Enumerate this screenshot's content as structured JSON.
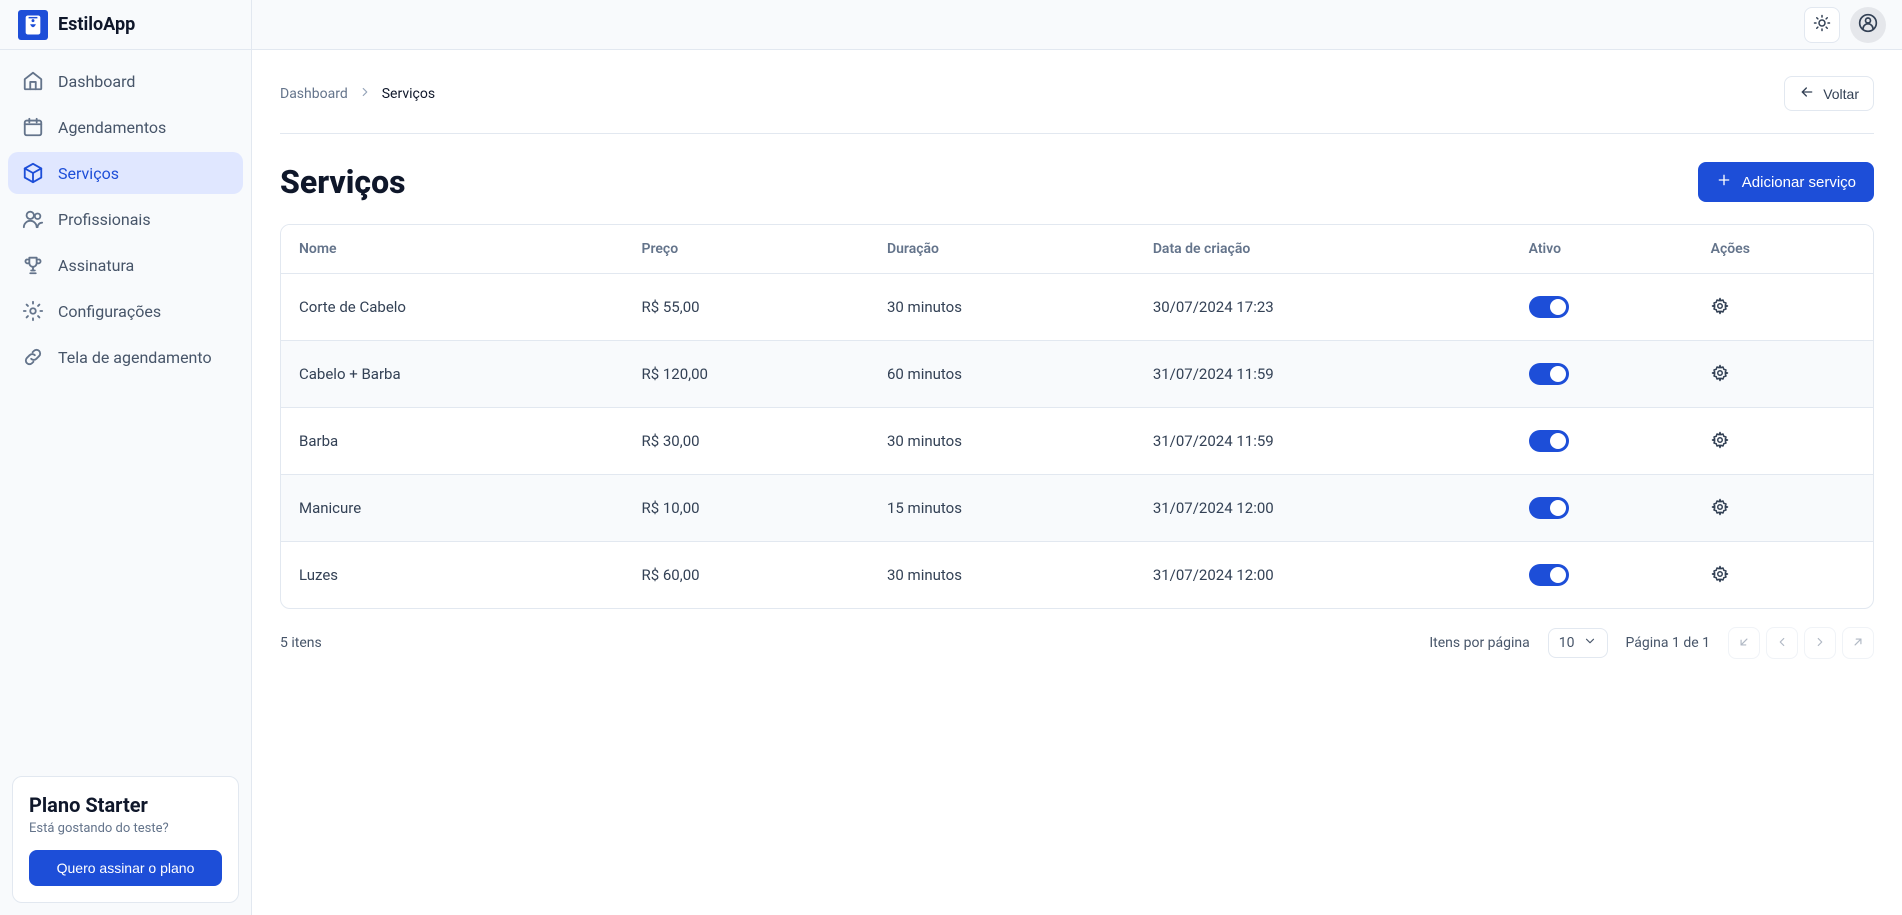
{
  "brand": "EstiloApp",
  "sidebar": {
    "items": [
      {
        "label": "Dashboard"
      },
      {
        "label": "Agendamentos"
      },
      {
        "label": "Serviços"
      },
      {
        "label": "Profissionais"
      },
      {
        "label": "Assinatura"
      },
      {
        "label": "Configurações"
      },
      {
        "label": "Tela de agendamento"
      }
    ]
  },
  "plan": {
    "title": "Plano Starter",
    "subtitle": "Está gostando do teste?",
    "cta": "Quero assinar o plano"
  },
  "breadcrumb": {
    "root": "Dashboard",
    "current": "Serviços"
  },
  "back_label": "Voltar",
  "page": {
    "title": "Serviços",
    "add_label": "Adicionar serviço"
  },
  "table": {
    "columns": {
      "name": "Nome",
      "price": "Preço",
      "duration": "Duração",
      "created": "Data de criação",
      "active": "Ativo",
      "actions": "Ações"
    },
    "rows": [
      {
        "name": "Corte de Cabelo",
        "price": "R$ 55,00",
        "duration": "30 minutos",
        "created": "30/07/2024 17:23",
        "active": true
      },
      {
        "name": "Cabelo + Barba",
        "price": "R$ 120,00",
        "duration": "60 minutos",
        "created": "31/07/2024 11:59",
        "active": true
      },
      {
        "name": "Barba",
        "price": "R$ 30,00",
        "duration": "30 minutos",
        "created": "31/07/2024 11:59",
        "active": true
      },
      {
        "name": "Manicure",
        "price": "R$ 10,00",
        "duration": "15 minutos",
        "created": "31/07/2024 12:00",
        "active": true
      },
      {
        "name": "Luzes",
        "price": "R$ 60,00",
        "duration": "30 minutos",
        "created": "31/07/2024 12:00",
        "active": true
      }
    ]
  },
  "pagination": {
    "total_label": "5 itens",
    "per_page_label": "Itens por página",
    "per_page_value": "10",
    "page_label": "Página 1 de 1"
  }
}
